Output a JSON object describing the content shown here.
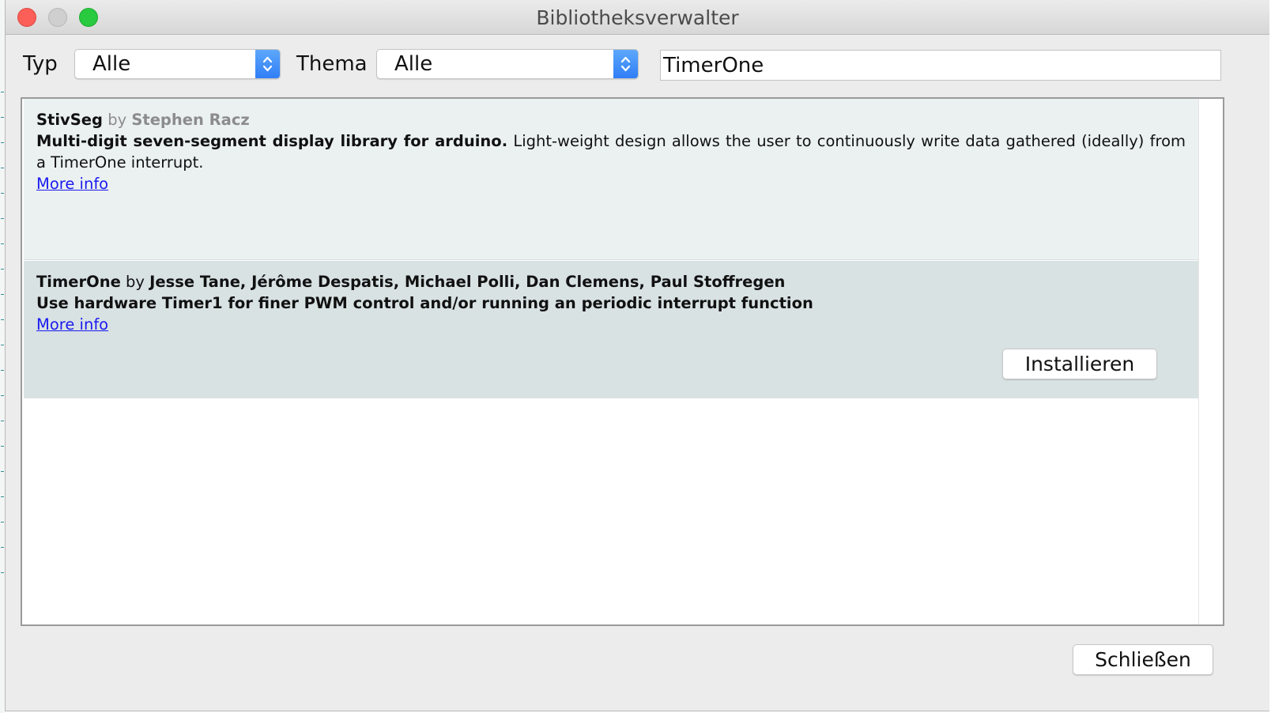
{
  "window": {
    "title": "Bibliotheksverwalter"
  },
  "filters": {
    "type_label": "Typ",
    "type_value": "Alle",
    "topic_label": "Thema",
    "topic_value": "Alle",
    "search_value": "TimerOne"
  },
  "libraries": [
    {
      "name": "StivSeg",
      "by": "by",
      "authors": "Stephen Racz",
      "summary": "Multi-digit seven-segment display library for arduino.",
      "description": "Light-weight design allows the user to continuously write data gathered (ideally) from a TimerOne interrupt.",
      "more_info": "More info"
    },
    {
      "name": "TimerOne",
      "by": "by",
      "authors": "Jesse Tane, Jérôme Despatis, Michael Polli, Dan Clemens, Paul Stoffregen",
      "summary": "Use hardware Timer1 for finer PWM control and/or running an periodic interrupt function",
      "more_info": "More info",
      "install_label": "Installieren"
    }
  ],
  "footer": {
    "close_label": "Schließen"
  },
  "colors": {
    "accent_blue": "#2f7ef6",
    "link": "#1a1aee",
    "row_first": "#ebf1f1",
    "row_selected": "#d9e2e3",
    "close_dot": "#fc5f57",
    "zoom_dot": "#29c940"
  },
  "icons": {
    "select_arrows": "updown-chevron-icon"
  }
}
